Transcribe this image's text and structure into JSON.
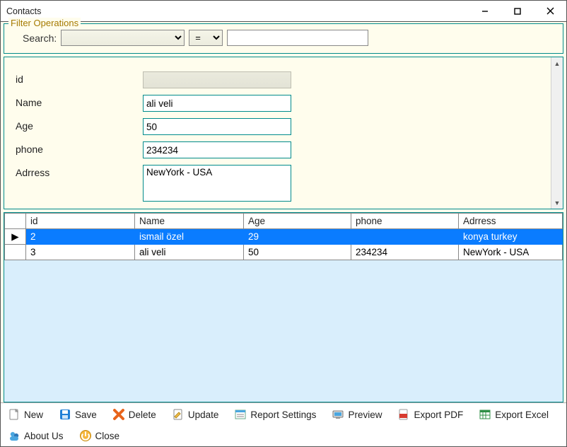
{
  "window": {
    "title": "Contacts"
  },
  "filter": {
    "legend": "Filter Operations",
    "search_label": "Search:",
    "field_value": "",
    "operator_value": "=",
    "search_value": ""
  },
  "form": {
    "fields": {
      "id": {
        "label": "id",
        "value": "",
        "readonly": true
      },
      "name": {
        "label": "Name",
        "value": "ali veli"
      },
      "age": {
        "label": "Age",
        "value": "50"
      },
      "phone": {
        "label": "phone",
        "value": "234234"
      },
      "address": {
        "label": "Adrress",
        "value": "NewYork - USA"
      }
    }
  },
  "grid": {
    "columns": [
      "id",
      "Name",
      "Age",
      "phone",
      "Adrress"
    ],
    "rows": [
      {
        "selected": true,
        "cells": [
          "2",
          "ismail özel",
          "29",
          "",
          "konya turkey"
        ]
      },
      {
        "selected": false,
        "cells": [
          "3",
          "ali veli",
          "50",
          "234234",
          "NewYork - USA"
        ]
      }
    ],
    "row_indicator": "▶"
  },
  "toolbar": {
    "new": "New",
    "save": "Save",
    "delete": "Delete",
    "update": "Update",
    "report": "Report Settings",
    "preview": "Preview",
    "pdf": "Export PDF",
    "excel": "Export Excel",
    "about": "About Us",
    "close": "Close"
  }
}
